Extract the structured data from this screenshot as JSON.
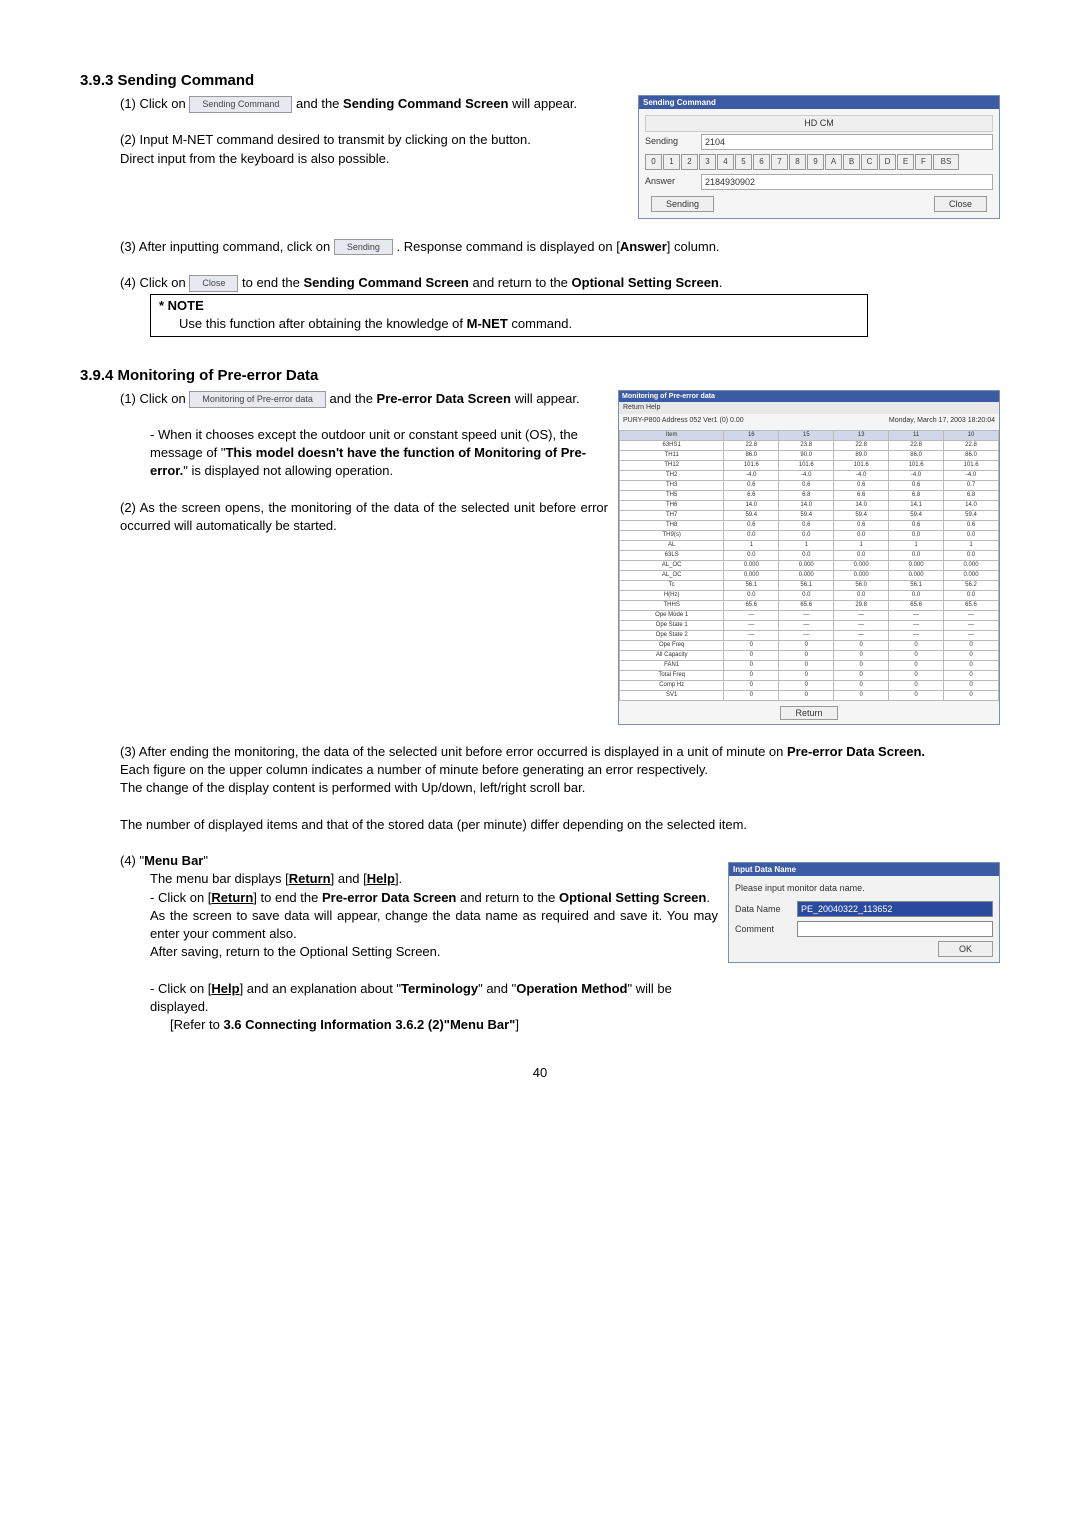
{
  "sections": {
    "s393": {
      "title": "3.9.3 Sending Command",
      "p1_a": "(1) Click on ",
      "p1_btn": "Sending Command",
      "p1_b": " and the ",
      "p1_bold": "Sending Command Screen",
      "p1_c": " will appear.",
      "p2": "(2) Input M-NET command desired to transmit by clicking on the button.",
      "p2b": "Direct input from the keyboard is also possible.",
      "p3_a": "(3) After inputting command, click on ",
      "p3_btn": "Sending",
      "p3_b": ". Response command is displayed on [",
      "p3_bold": "Answer",
      "p3_c": "] column.",
      "p4_a": "(4) Click on ",
      "p4_btn": "Close",
      "p4_b": " to end the ",
      "p4_bold1": "Sending Command Screen",
      "p4_c": " and return to the ",
      "p4_bold2": "Optional Setting Screen",
      "p4_d": ".",
      "note_label": "* NOTE",
      "note_a": "Use this function after obtaining the knowledge of ",
      "note_bold": "M-NET",
      "note_b": " command."
    },
    "s394": {
      "title": "3.9.4 Monitoring of Pre-error Data",
      "p1_a": "(1) Click on ",
      "p1_btn": "Monitoring of Pre-error data",
      "p1_b": " and the ",
      "p1_bold": "Pre-error Data Screen",
      "p1_c": " will appear.",
      "p1_warn_a": "- When it chooses except the outdoor unit or constant speed unit (OS),   the message of \"",
      "p1_warn_bold": "This model doesn't have the function of Monitoring of Pre-error.",
      "p1_warn_b": "\" is displayed not allowing operation.",
      "p2": "(2) As the screen opens, the monitoring of the data of the selected unit before error occurred will automatically be started.",
      "p3_a": "(3)  After ending the monitoring, the data of the selected unit before error occurred is displayed in a unit of minute on ",
      "p3_bold": "Pre-error Data Screen.",
      "p3_b": "Each figure on the upper column indicates a number of minute before generating an error respectively.",
      "p3_c": "The change of the display content is performed with Up/down, left/right scroll bar.",
      "p3_d": "The number of displayed items and that of the stored data (per minute) differ depending on the selected item.",
      "p4_label": "(4) \"Menu Bar\"",
      "p4_a": "The menu bar displays [",
      "p4_bold_return": "Return",
      "p4_b": "] and [",
      "p4_bold_help": "Help",
      "p4_c": "].",
      "p4_ret_a": " - Click on [",
      "p4_ret_b": "] to end the ",
      "p4_ret_bold": "Pre-error Data Screen",
      "p4_ret_c": " and return to the ",
      "p4_ret_bold2": "Optional Setting Screen",
      "p4_ret_d": ".",
      "p4_save": "As the screen to save data will appear, change the data name as required and save it. You may enter your comment also.",
      "p4_save2": "After saving, return to the Optional Setting Screen.",
      "p4_help_a": "-  Click on [",
      "p4_help_b": "] and an explanation about \"",
      "p4_help_bold1": "Terminology",
      "p4_help_c": "\" and \"",
      "p4_help_bold2": "Operation Method",
      "p4_help_d": "\" will be displayed.",
      "p4_ref_a": "[Refer to ",
      "p4_ref_bold": "3.6 Connecting Information    3.6.2 (2)\"Menu Bar\"",
      "p4_ref_b": "]"
    }
  },
  "sending_window": {
    "title": "Sending Command",
    "hdcm": "HD CM",
    "sending_label": "Sending",
    "sending_value": "2104",
    "keys": [
      "0",
      "1",
      "2",
      "3",
      "4",
      "5",
      "6",
      "7",
      "8",
      "9",
      "A",
      "B",
      "C",
      "D",
      "E",
      "F",
      "BS"
    ],
    "answer_label": "Answer",
    "answer_value": "2184930902",
    "btn_sending": "Sending",
    "btn_close": "Close"
  },
  "preerror_window": {
    "title": "Monitoring of Pre-error data",
    "menu": "Return   Help",
    "hdr_left": "PURY-P800   Address 052   Ver1 (0) 0.00",
    "hdr_right": "Monday, March 17, 2003 18:20:04",
    "cols": [
      "Item",
      "16",
      "15",
      "13",
      "11",
      "10"
    ],
    "rows": [
      [
        "63HS1",
        "22.8",
        "23.8",
        "22.8",
        "22.8",
        "22.8"
      ],
      [
        "TH11",
        "86.0",
        "90.0",
        "89.0",
        "86.0",
        "86.0"
      ],
      [
        "TH12",
        "101.6",
        "101.6",
        "101.6",
        "101.6",
        "101.6"
      ],
      [
        "TH2",
        "-4.0",
        "-4.0",
        "-4.0",
        "-4.0",
        "-4.0"
      ],
      [
        "TH3",
        "0.6",
        "0.6",
        "0.6",
        "0.6",
        "0.7"
      ],
      [
        "TH5",
        "6.6",
        "6.8",
        "6.6",
        "6.8",
        "6.8"
      ],
      [
        "TH6",
        "14.0",
        "14.0",
        "14.0",
        "14.1",
        "14.0"
      ],
      [
        "TH7",
        "59.4",
        "59.4",
        "59.4",
        "59.4",
        "59.4"
      ],
      [
        "TH8",
        "0.6",
        "0.6",
        "0.6",
        "0.6",
        "0.6"
      ],
      [
        "TH9(s)",
        "0.0",
        "0.0",
        "0.0",
        "0.0",
        "0.0"
      ],
      [
        "AL",
        "1",
        "1",
        "1",
        "1",
        "1"
      ],
      [
        "63LS",
        "0.0",
        "0.0",
        "0.0",
        "0.0",
        "0.0"
      ],
      [
        "AL_OC",
        "0.000",
        "0.000",
        "0.000",
        "0.000",
        "0.000"
      ],
      [
        "AL_OC",
        "0.000",
        "0.000",
        "0.000",
        "0.000",
        "0.000"
      ],
      [
        "Tc",
        "56.1",
        "56.1",
        "56.0",
        "56.1",
        "56.2"
      ],
      [
        "H(Hz)",
        "0.0",
        "0.0",
        "0.0",
        "0.0",
        "0.0"
      ],
      [
        "THHS",
        "65.6",
        "65.6",
        "29.8",
        "65.6",
        "65.6"
      ],
      [
        "Ope Mode 1",
        "—",
        "—",
        "—",
        "—",
        "—"
      ],
      [
        "Ope State 1",
        "—",
        "—",
        "—",
        "—",
        "—"
      ],
      [
        "Ope State 2",
        "—",
        "—",
        "—",
        "—",
        "—"
      ],
      [
        "Ope Freq",
        "0",
        "0",
        "0",
        "0",
        "0"
      ],
      [
        "All Capacity",
        "0",
        "0",
        "0",
        "0",
        "0"
      ],
      [
        "FAN1",
        "0",
        "0",
        "0",
        "0",
        "0"
      ],
      [
        "Total Freq",
        "0",
        "0",
        "0",
        "0",
        "0"
      ],
      [
        "Comp Hz",
        "0",
        "0",
        "0",
        "0",
        "0"
      ],
      [
        "SV1",
        "0",
        "0",
        "0",
        "0",
        "0"
      ]
    ],
    "btn_return": "Return"
  },
  "input_data_name": {
    "title": "Input Data Name",
    "msg": "Please input monitor data name.",
    "label_name": "Data Name",
    "value_name": "PE_20040322_113652",
    "label_comment": "Comment",
    "value_comment": "",
    "btn_ok": "OK"
  },
  "page_number": "40"
}
